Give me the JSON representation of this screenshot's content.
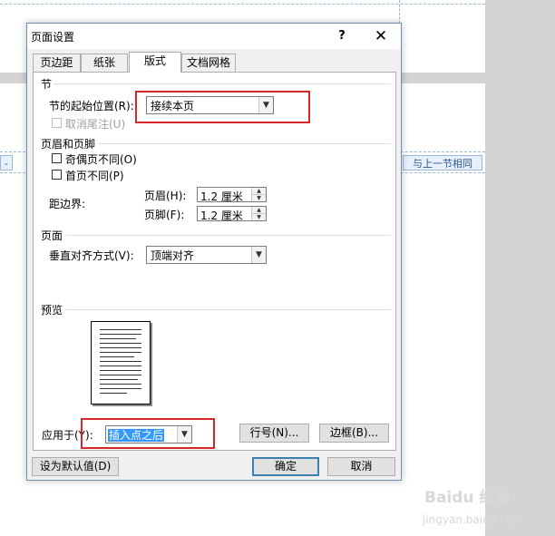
{
  "background": {
    "header_tag_left": "-",
    "same_as_previous": "与上一节相同"
  },
  "dialog": {
    "title": "页面设置",
    "help": "?",
    "close": "✕",
    "tabs": [
      {
        "label": "页边距",
        "active": false
      },
      {
        "label": "纸张",
        "active": false
      },
      {
        "label": "版式",
        "active": true
      },
      {
        "label": "文档网格",
        "active": false
      }
    ],
    "section": {
      "title": "节",
      "start_label": "节的起始位置(R):",
      "start_value": "接续本页",
      "suppress_endnotes_label": "取消尾注(U)"
    },
    "header_footer": {
      "title": "页眉和页脚",
      "odd_even_label": "奇偶页不同(O)",
      "first_page_label": "首页不同(P)",
      "distance_label": "距边界:",
      "header_label": "页眉(H):",
      "header_value": "1.2 厘米",
      "footer_label": "页脚(F):",
      "footer_value": "1.2 厘米"
    },
    "page": {
      "title": "页面",
      "valign_label": "垂直对齐方式(V):",
      "valign_value": "顶端对齐"
    },
    "preview": {
      "title": "预览"
    },
    "apply_to_label": "应用于(Y):",
    "apply_to_value": "插入点之后",
    "line_numbers_button": "行号(N)...",
    "borders_button": "边框(B)...",
    "set_default_button": "设为默认值(D)",
    "ok_button": "确定",
    "cancel_button": "取消"
  },
  "watermark": {
    "logo_text": "Baidu 经验",
    "url": "jingyan.baidu.com"
  },
  "colors": {
    "highlight_box": "#d9262b",
    "selection": "#3399ff",
    "default_button_border": "#3c7fb1"
  }
}
